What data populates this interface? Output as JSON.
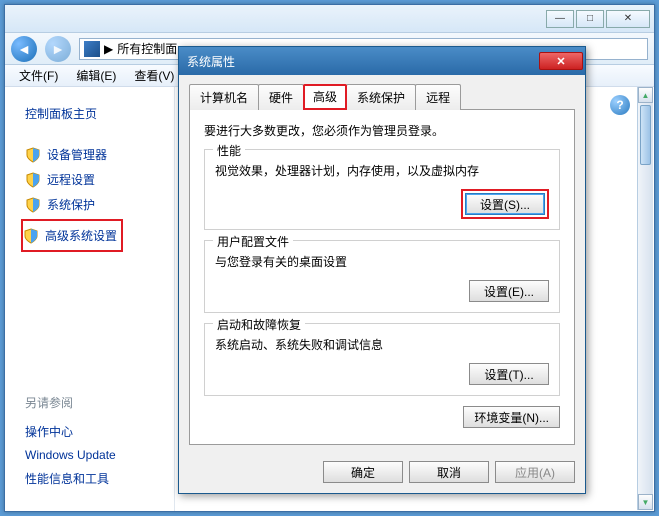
{
  "parent": {
    "breadcrumb_sep": "▶",
    "breadcrumb_text": "所有控制面",
    "menu": {
      "file": "文件(F)",
      "edit": "编辑(E)",
      "view": "查看(V)"
    }
  },
  "sidebar": {
    "heading": "控制面板主页",
    "items": [
      {
        "label": "设备管理器"
      },
      {
        "label": "远程设置"
      },
      {
        "label": "系统保护"
      },
      {
        "label": "高级系统设置"
      }
    ],
    "refs_title": "另请参阅",
    "refs": [
      {
        "label": "操作中心"
      },
      {
        "label": "Windows Update"
      },
      {
        "label": "性能信息和工具"
      }
    ]
  },
  "dialog": {
    "title": "系统属性",
    "tabs": {
      "computer_name": "计算机名",
      "hardware": "硬件",
      "advanced": "高级",
      "system_protection": "系统保护",
      "remote": "远程"
    },
    "note": "要进行大多数更改，您必须作为管理员登录。",
    "perf": {
      "title": "性能",
      "desc": "视觉效果，处理器计划，内存使用，以及虚拟内存",
      "btn": "设置(S)..."
    },
    "profile": {
      "title": "用户配置文件",
      "desc": "与您登录有关的桌面设置",
      "btn": "设置(E)..."
    },
    "startup": {
      "title": "启动和故障恢复",
      "desc": "系统启动、系统失败和调试信息",
      "btn": "设置(T)..."
    },
    "env_btn": "环境变量(N)...",
    "ok": "确定",
    "cancel": "取消",
    "apply": "应用(A)"
  },
  "help_glyph": "?"
}
